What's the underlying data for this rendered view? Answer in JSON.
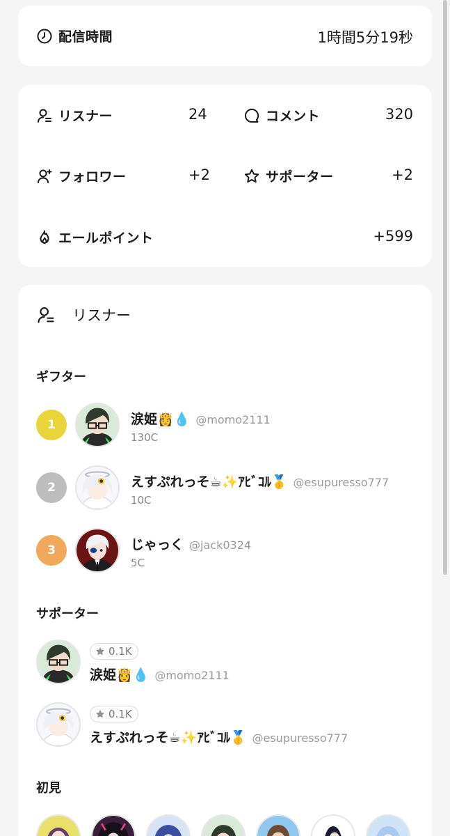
{
  "broadcast": {
    "label": "配信時間",
    "value": "1時間5分19秒"
  },
  "stats": {
    "listeners": {
      "label": "リスナー",
      "value": "24"
    },
    "comments": {
      "label": "コメント",
      "value": "320"
    },
    "followers": {
      "label": "フォロワー",
      "value": "+2"
    },
    "supporters": {
      "label": "サポーター",
      "value": "+2"
    },
    "yell_points": {
      "label": "エールポイント",
      "value": "+599"
    }
  },
  "listener_section": {
    "title": "リスナー",
    "gifters_title": "ギフター",
    "gifters": [
      {
        "rank": "1",
        "name": "涙姫👸💧",
        "handle": "@momo2111",
        "coins": "130C"
      },
      {
        "rank": "2",
        "name": "えすぷれっそ☕✨ｱﾋﾞｺﾙ🥇",
        "handle": "@esupuresso777",
        "coins": "10C"
      },
      {
        "rank": "3",
        "name": "じゃっく",
        "handle": "@jack0324",
        "coins": "5C"
      }
    ],
    "supporters_title": "サポーター",
    "supporters": [
      {
        "badge": "0.1K",
        "name": "涙姫👸💧",
        "handle": "@momo2111"
      },
      {
        "badge": "0.1K",
        "name": "えすぷれっそ☕✨ｱﾋﾞｺﾙ🥇",
        "handle": "@esupuresso777"
      }
    ],
    "first_time_title": "初見"
  },
  "colors": {
    "rank1": "#e8d53a",
    "rank2": "#bdbdbd",
    "rank3": "#f0a95a",
    "background": "#f5f5f5",
    "card": "#ffffff"
  },
  "icons": {
    "broadcast": "clock-icon",
    "listeners": "user-list-icon",
    "comments": "chat-bubble-icon",
    "followers": "user-plus-icon",
    "supporters": "star-icon",
    "yell_points": "flame-icon",
    "badge": "star-filled-icon"
  }
}
